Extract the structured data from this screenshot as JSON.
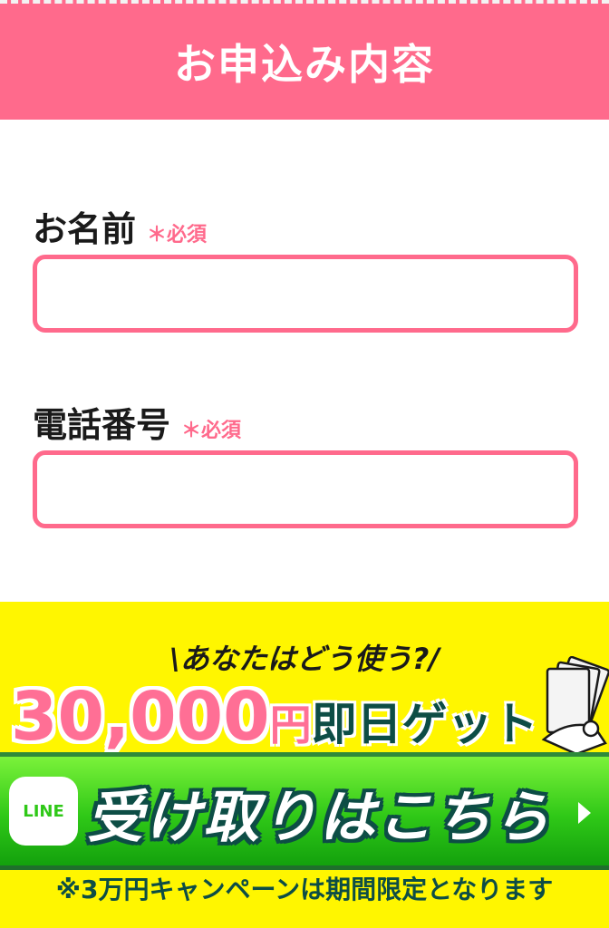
{
  "header": {
    "title": "お申込み内容"
  },
  "form": {
    "name": {
      "label": "お名前",
      "required": "＊必須",
      "value": ""
    },
    "phone": {
      "label": "電話番号",
      "required": "＊必須",
      "value": ""
    }
  },
  "banner": {
    "subtitle": "\\あなたはどう使う?/",
    "amount": "30,000",
    "amount_unit": "円",
    "amount_suffix": "即日ゲット",
    "line_logo": "LINE",
    "button_label": "受け取りはこちら",
    "note": "※3万円キャンペーンは期間限定となります"
  },
  "colors": {
    "accent_pink": "#ff6a8c",
    "banner_yellow": "#fff600",
    "line_green": "#2fc817",
    "dark_green": "#0d4d45"
  },
  "icons": {
    "line_logo": "line-logo-icon",
    "arrow": "triangle-right-icon",
    "money": "money-hand-icon"
  }
}
